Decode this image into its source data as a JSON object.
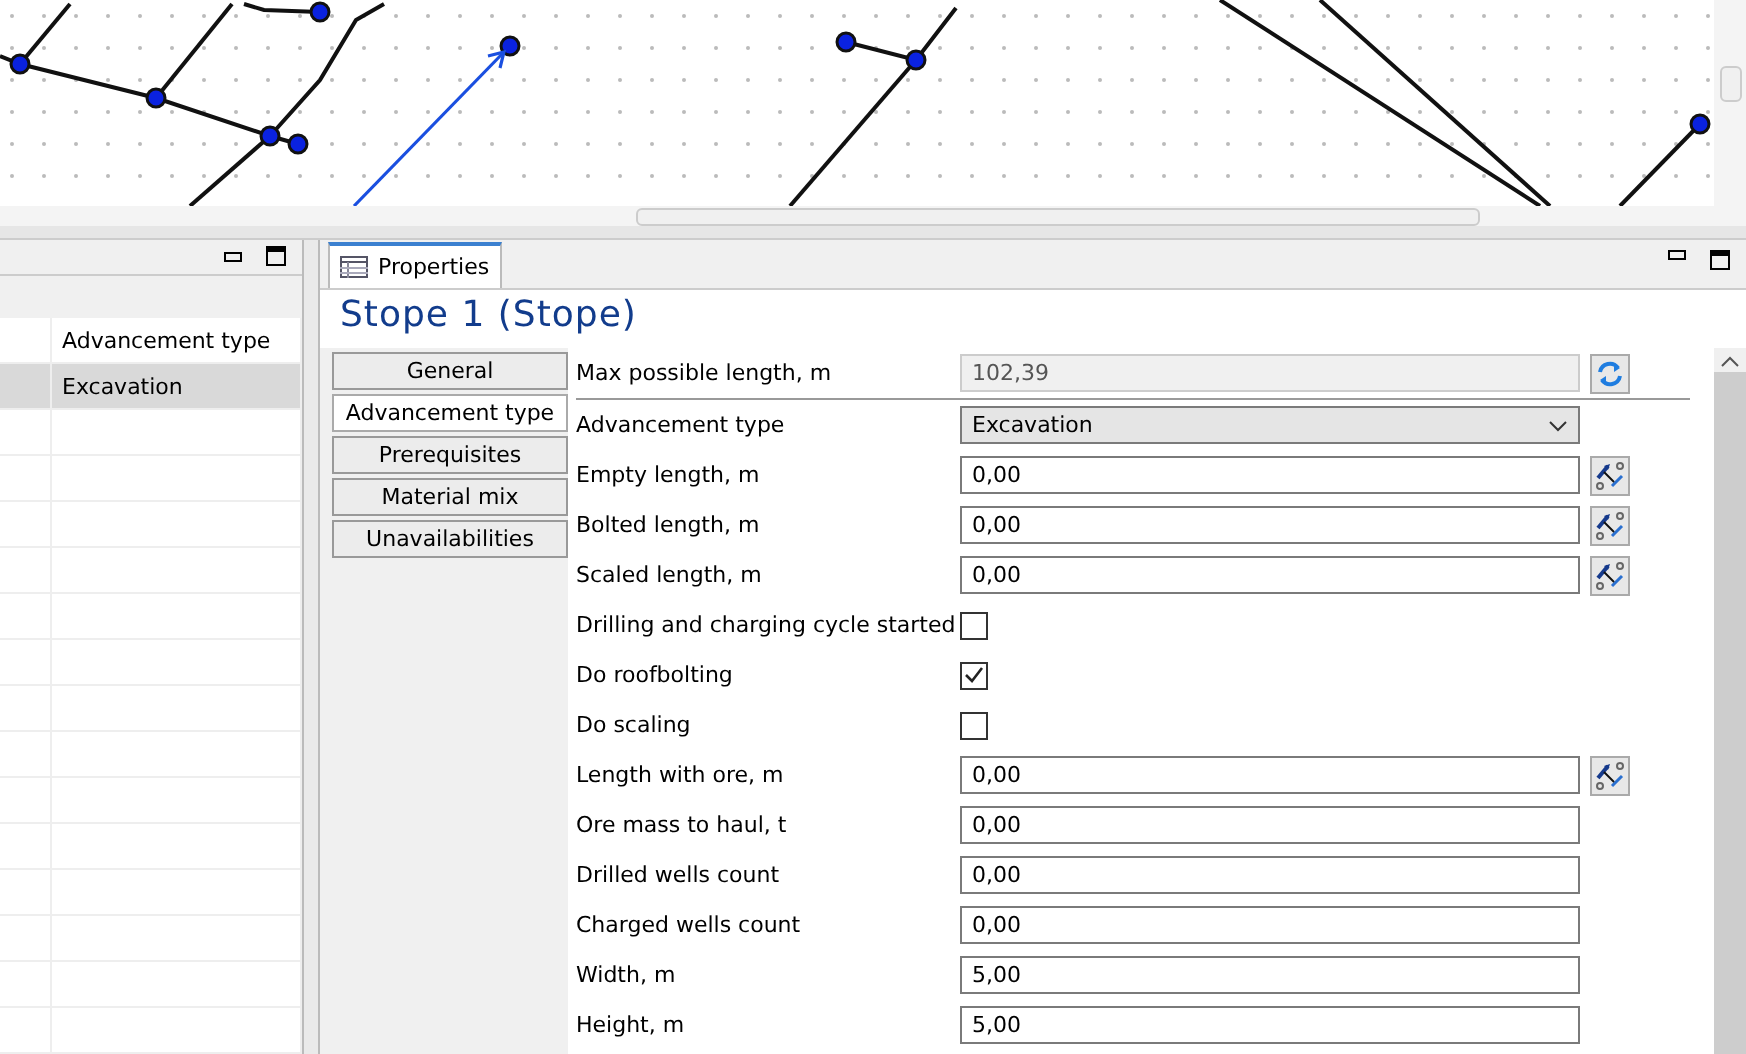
{
  "left_panel": {
    "table": {
      "columns": [
        "Advancement type"
      ],
      "rows": [
        {
          "cells": [
            "Excavation"
          ],
          "selected": true
        }
      ]
    }
  },
  "properties": {
    "tab": {
      "label": "Properties",
      "selected": true
    },
    "title": "Stope 1 (Stope)",
    "side_tabs": [
      {
        "label": "General",
        "selected": false
      },
      {
        "label": "Advancement type",
        "selected": true
      },
      {
        "label": "Prerequisites",
        "selected": false
      },
      {
        "label": "Material mix",
        "selected": false
      },
      {
        "label": "Unavailabilities",
        "selected": false
      }
    ],
    "fields": [
      {
        "kind": "readonly",
        "label": "Max possible length, m",
        "value": "102,39"
      },
      {
        "kind": "select",
        "label": "Advancement type",
        "value": "Excavation"
      },
      {
        "kind": "picker",
        "label": "Empty length, m",
        "value": "0,00"
      },
      {
        "kind": "picker",
        "label": "Bolted length, m",
        "value": "0,00"
      },
      {
        "kind": "picker",
        "label": "Scaled length, m",
        "value": "0,00"
      },
      {
        "kind": "checkbox",
        "label": "Drilling and charging cycle started",
        "checked": false
      },
      {
        "kind": "checkbox",
        "label": "Do roofbolting",
        "checked": true
      },
      {
        "kind": "checkbox",
        "label": "Do scaling",
        "checked": false
      },
      {
        "kind": "picker",
        "label": "Length with ore, m",
        "value": "0,00"
      },
      {
        "kind": "input",
        "label": "Ore mass to haul, t",
        "value": "0,00"
      },
      {
        "kind": "input",
        "label": "Drilled wells count",
        "value": "0,00"
      },
      {
        "kind": "input",
        "label": "Charged wells count",
        "value": "0,00"
      },
      {
        "kind": "input",
        "label": "Width, m",
        "value": "5,00"
      },
      {
        "kind": "input",
        "label": "Height, m",
        "value": "5,00"
      }
    ]
  }
}
